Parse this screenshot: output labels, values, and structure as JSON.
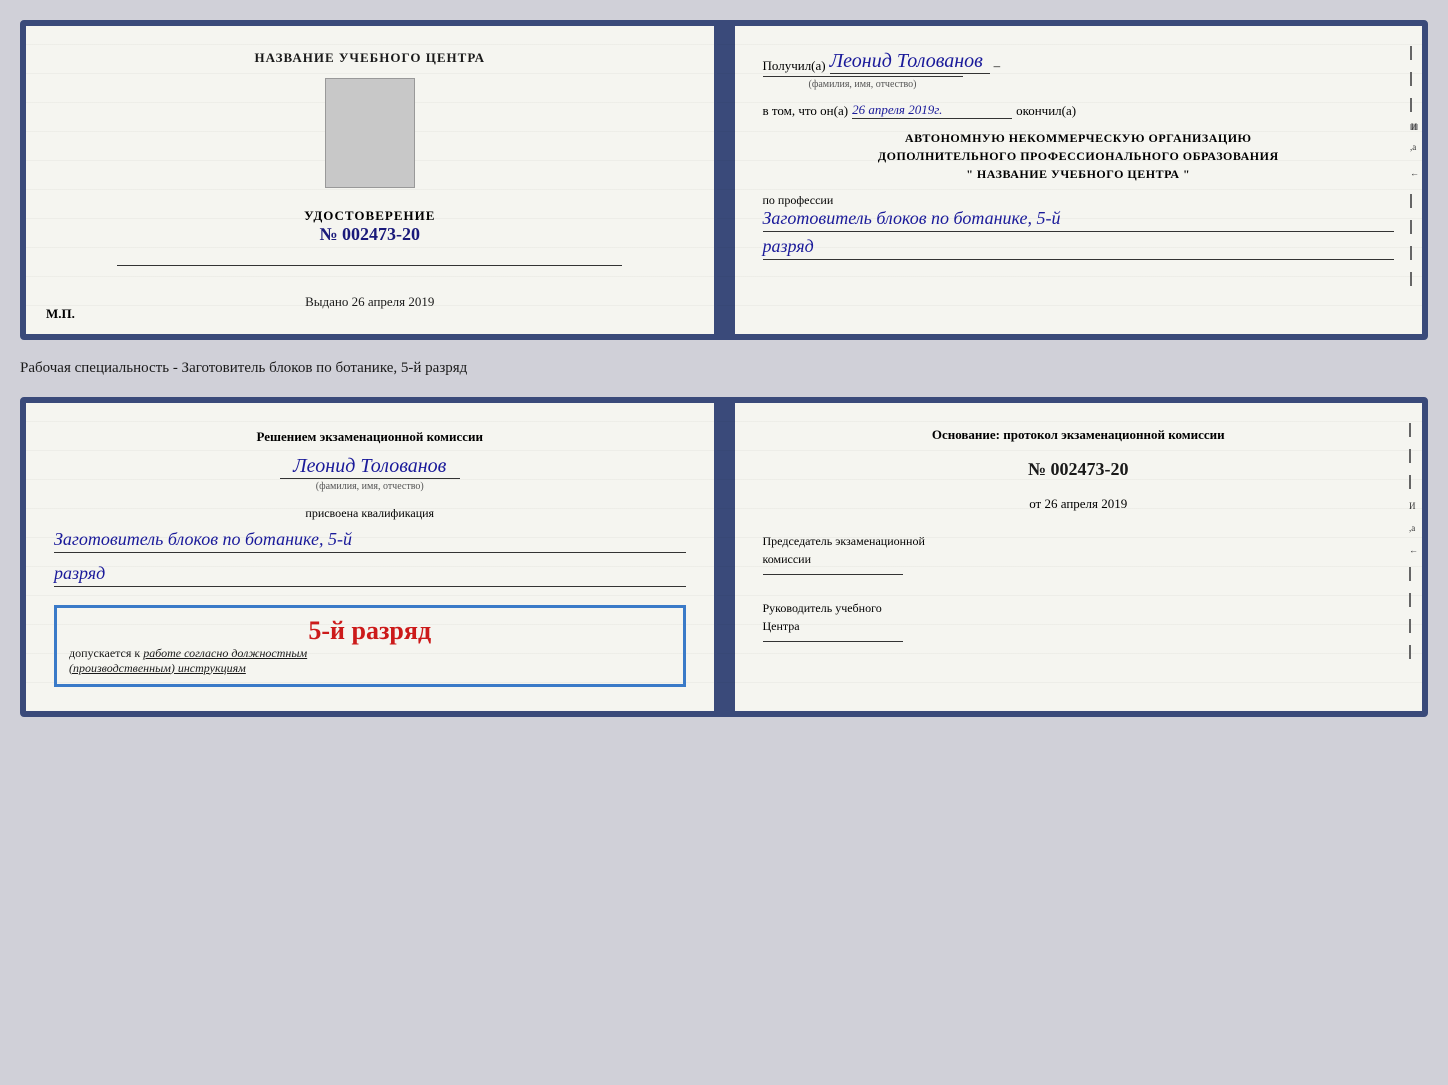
{
  "page": {
    "background_color": "#d0d0d8"
  },
  "card1": {
    "left": {
      "title": "НАЗВАНИЕ УЧЕБНОГО ЦЕНТРА",
      "udostoverenie_label": "УДОСТОВЕРЕНИЕ",
      "number_prefix": "№",
      "number": "002473-20",
      "vydano_label": "Выдано",
      "vydano_date": "26 апреля 2019",
      "mp_label": "М.П."
    },
    "right": {
      "poluchil_prefix": "Получил(а)",
      "recipient_name": "Леонид Толованов",
      "fio_label": "(фамилия, имя, отчество)",
      "vtom_prefix": "в том, что он(а)",
      "vtom_date": "26 апреля 2019г.",
      "okончил_label": "окончил(а)",
      "org_line1": "АВТОНОМНУЮ НЕКОММЕРЧЕСКУЮ ОРГАНИЗАЦИЮ",
      "org_line2": "ДОПОЛНИТЕЛЬНОГО ПРОФЕССИОНАЛЬНОГО ОБРАЗОВАНИЯ",
      "org_line3": "\"  НАЗВАНИЕ УЧЕБНОГО ЦЕНТРА  \"",
      "po_professii_label": "по профессии",
      "profession": "Заготовитель блоков по ботанике, 5-й",
      "razryad": "разряд"
    }
  },
  "specialty_label": "Рабочая специальность - Заготовитель блоков по ботанике, 5-й разряд",
  "card2": {
    "left": {
      "decision_line1": "Решением экзаменационной комиссии",
      "person_name": "Леонид Толованов",
      "fio_label": "(фамилия, имя, отчество)",
      "prisvoena_label": "присвоена квалификация",
      "profession": "Заготовитель блоков по ботанике, 5-й",
      "razryad": "разряд",
      "stamp_grade": "5-й разряд",
      "stamp_dopuskaetsya": "допускается к",
      "stamp_rabote": "работе согласно должностным",
      "stamp_instruktsiyam": "(производственным) инструкциям"
    },
    "right": {
      "osnov_label": "Основание: протокол экзаменационной комиссии",
      "number_prefix": "№",
      "protocol_number": "002473-20",
      "ot_prefix": "от",
      "protocol_date": "26 апреля 2019",
      "chairman_line1": "Председатель экзаменационной",
      "chairman_line2": "комиссии",
      "head_line1": "Руководитель учебного",
      "head_line2": "Центра"
    }
  }
}
